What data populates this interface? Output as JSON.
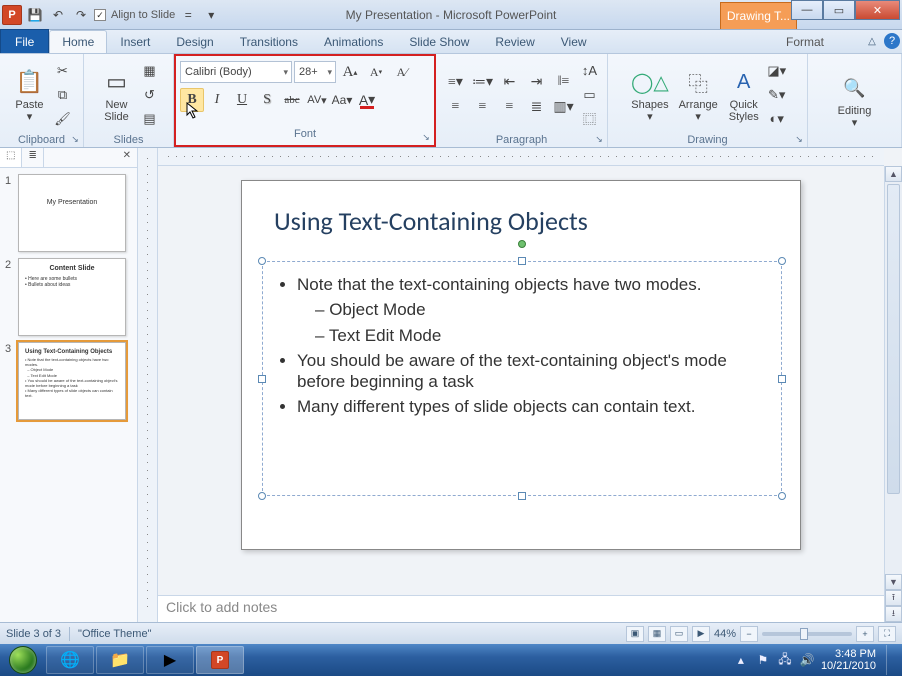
{
  "titlebar": {
    "app_icon_letter": "P",
    "align_label": "Align to Slide",
    "center_title": "My Presentation  -  Microsoft PowerPoint",
    "context_tab": "Drawing T...",
    "min": "—",
    "max": "▭",
    "close": "✕"
  },
  "tabs": {
    "file": "File",
    "items": [
      "Home",
      "Insert",
      "Design",
      "Transitions",
      "Animations",
      "Slide Show",
      "Review",
      "View"
    ],
    "active_index": 0,
    "format": "Format"
  },
  "ribbon": {
    "clipboard": {
      "label": "Clipboard",
      "paste": "Paste"
    },
    "slides": {
      "label": "Slides",
      "new_slide": "New\nSlide"
    },
    "font": {
      "label": "Font",
      "name": "Calibri (Body)",
      "size": "28+",
      "grow": "A▴",
      "shrink": "A▾",
      "clear": "A⁄",
      "bold": "B",
      "italic": "I",
      "underline": "U",
      "strike": "S",
      "strike2": "abc",
      "spacing": "AV",
      "case": "Aa",
      "color": "A"
    },
    "paragraph": {
      "label": "Paragraph"
    },
    "drawing": {
      "label": "Drawing",
      "shapes": "Shapes",
      "arrange": "Arrange",
      "quick": "Quick\nStyles"
    },
    "editing": {
      "label": "Editing"
    }
  },
  "thumbs": {
    "tab_slides": "⬚",
    "tab_outline": "≣",
    "items": [
      {
        "num": "1",
        "title": "My Presentation"
      },
      {
        "num": "2",
        "title": "Content Slide"
      },
      {
        "num": "3",
        "title": "Using Text-Containing Objects"
      }
    ],
    "selected": 2
  },
  "slide": {
    "title": "Using Text-Containing Objects",
    "bullets": [
      "Note that the text-containing objects have two modes.",
      "You should be aware of the text-containing object's mode before beginning a task",
      "Many different types of slide objects can contain text."
    ],
    "sub_bullets": [
      "Object Mode",
      "Text Edit Mode"
    ]
  },
  "notes_placeholder": "Click to add notes",
  "status": {
    "slide": "Slide 3 of 3",
    "theme": "\"Office Theme\"",
    "zoom": "44%"
  },
  "tray": {
    "time": "3:48 PM",
    "date": "10/21/2010"
  }
}
